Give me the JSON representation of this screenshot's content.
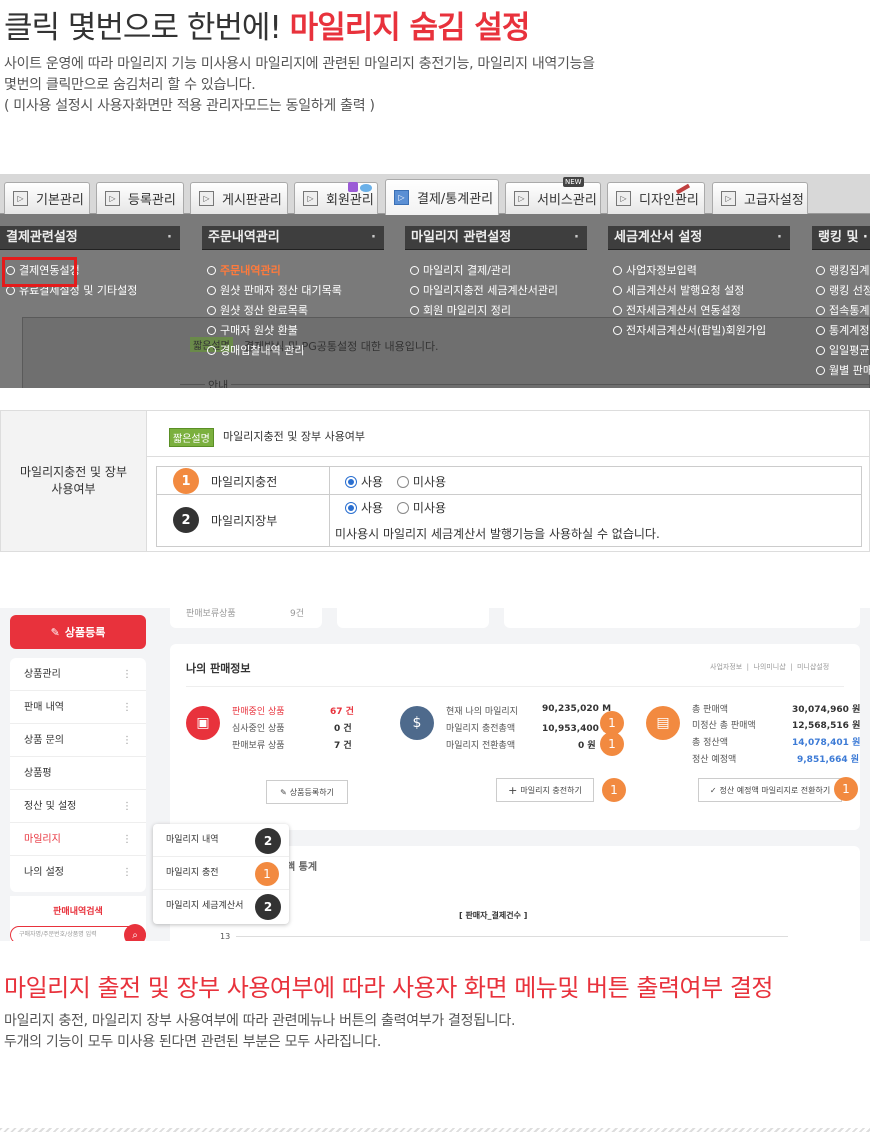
{
  "section1": {
    "title_prefix": "클릭 몇번으로 한번에! ",
    "title_highlight": "마일리지 숨김 설정",
    "desc_lines": [
      "사이트 운영에 따라 마일리지 기능 미사용시 마일리지에 관련된 마일리지 충전기능, 마일리지 내역기능을",
      "몇번의 클릭만으로 숨김처리 할 수 있습니다.",
      "( 미사용 설정시 사용자화면만 적용 관리자모드는 동일하게 출력 )"
    ]
  },
  "admin": {
    "tabs": [
      "기본관리",
      "등록관리",
      "게시판관리",
      "회원관리",
      "결제/통계관리",
      "서비스관리",
      "디자인관리",
      "고급자설정"
    ],
    "active_tab": "결제/통계관리",
    "new_badge": "NEW",
    "menu_heads": [
      "결제관련설정",
      "주문내역관리",
      "마일리지 관련설정",
      "세금계산서 설정",
      "랭킹 및 ·"
    ],
    "col1": [
      "결제연동설정",
      "유료결제설정 및 기타설정"
    ],
    "col2": [
      "주문내역관리",
      "원샷 판매자 정산 대기목록",
      "원샷 정산 완료목록",
      "구매자 원샷 환불",
      "경매입찰내역 관리"
    ],
    "col3": [
      "마일리지 결제/관리",
      "마일리지충전 세금계산서관리",
      "회원 마일리지 정리"
    ],
    "col4": [
      "사업자정보입력",
      "세금계산서 발행요청 설정",
      "전자세금계산서 연동설정",
      "전자세금계산서(팝빌)회원가입"
    ],
    "col5": [
      "랭킹집계",
      "랭킹 선정",
      "접속통계",
      "통계계정",
      "일일평균",
      "월별 판매"
    ],
    "dim_badge": "짧은설명",
    "dim_desc": "결제방식 및 PG공통설정 대한 내용입니다.",
    "dim_label": "안내"
  },
  "settings": {
    "left_label_1": "마일리지충전 및 장부",
    "left_label_2": "사용여부",
    "badge": "짧은설명",
    "desc": "마일리지충전 및 장부 사용여부",
    "row1_num": "1",
    "row1_label": "마일리지충전",
    "row2_num": "2",
    "row2_label": "마일리지장부",
    "opt_use": "사용",
    "opt_nouse": "미사용",
    "note": "미사용시 마일리지 세금계산서 발행기능을 사용하실 수 없습니다."
  },
  "dash": {
    "top_left_text": "판매보류상품",
    "top_left_val": "9건",
    "register_btn": "상품등록",
    "side_items": [
      "상품관리",
      "판매 내역",
      "상품 문의",
      "상품평",
      "정산 및 설정",
      "마일리지",
      "나의 설정"
    ],
    "side_search": "판매내역검색",
    "search_placeholder": "구매자명/주문번호/상품명 입력",
    "info_title": "나의 판매정보",
    "info_links": [
      "사업자정보",
      "나의미니샵",
      "미니샵설정"
    ],
    "g1": [
      [
        "판매중인 상품",
        "67 건"
      ],
      [
        "심사중인 상품",
        "0 건"
      ],
      [
        "판매보류 상품",
        "7 건"
      ]
    ],
    "g2": [
      [
        "현재 나의 마일리지",
        "90,235,020 M"
      ],
      [
        "마일리지 충전총액",
        "10,953,400 원"
      ],
      [
        "마일리지 전환총액",
        "0 원"
      ]
    ],
    "g3": [
      [
        "총 판매액",
        "30,074,960 원"
      ],
      [
        "미정산 총 판매액",
        "12,568,516 원"
      ],
      [
        "총 정산액",
        "14,078,401 원"
      ],
      [
        "정산 예정액",
        "9,851,664 원"
      ]
    ],
    "btn1": "상품등록하기",
    "btn2": "마일리지 충전하기",
    "btn3": "정산 예정액 마일리지로 전환하기",
    "stats_title": "판매액 통계",
    "stats_visible": "액 통계",
    "chart_title": "[ 판매자_결제건수 ]",
    "chart_tick": "13",
    "popup_items": [
      "마일리지 내역",
      "마일리지 충전",
      "마일리지 세금계산서"
    ],
    "n1": "1",
    "n2": "2"
  },
  "section2": {
    "title": "마일리지 출전 및 장부 사용여부에 따라 사용자 화면 메뉴및 버튼 출력여부 결정",
    "desc_lines": [
      "마일리지 충전, 마일리지 장부 사용여부에 따라 관련메뉴나 버튼의 출력여부가 결정됩니다.",
      "두개의 기능이 모두 미사용 된다면 관련된 부분은 모두 사라집니다."
    ]
  },
  "colors": {
    "accent_red": "#e8323c",
    "orange": "#f28a40",
    "dark": "#333333",
    "green": "#7bb03e"
  }
}
